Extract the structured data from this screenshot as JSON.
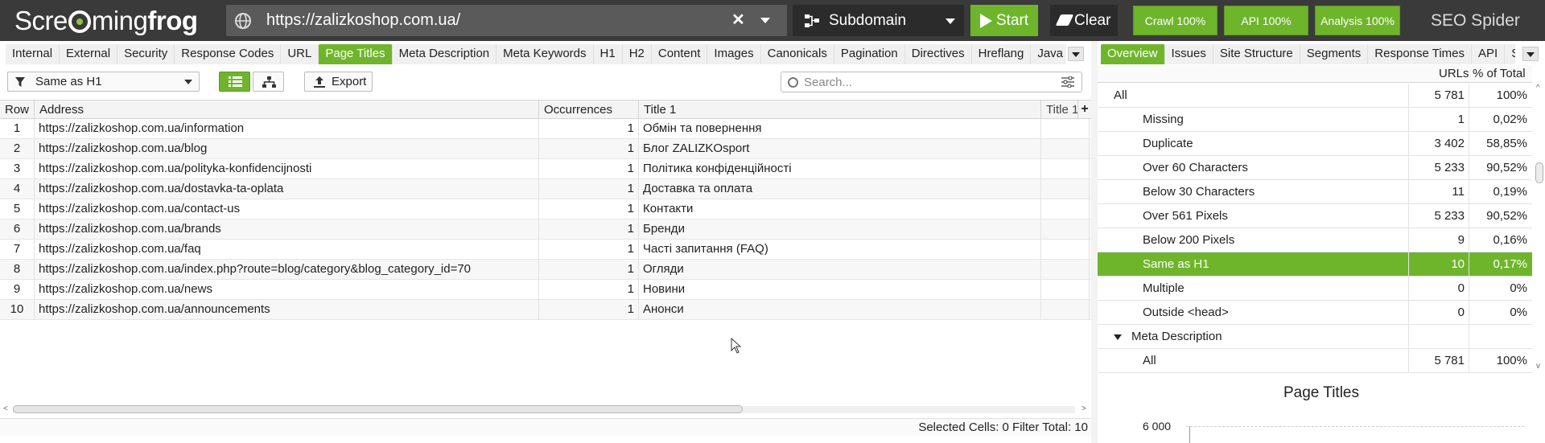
{
  "app": {
    "logo_part1": "Scre",
    "logo_part2": "ming",
    "logo_part3": "frog",
    "brand": "SEO Spider",
    "url": "https://zalizkoshop.com.ua/",
    "mode": "Subdomain",
    "start_label": "Start",
    "clear_label": "Clear",
    "status": {
      "crawl": "Crawl 100%",
      "api": "API 100%",
      "analysis": "Analysis 100%"
    }
  },
  "left_tabs": [
    "Internal",
    "External",
    "Security",
    "Response Codes",
    "URL",
    "Page Titles",
    "Meta Description",
    "Meta Keywords",
    "H1",
    "H2",
    "Content",
    "Images",
    "Canonicals",
    "Pagination",
    "Directives",
    "Hreflang",
    "Java"
  ],
  "left_active_tab": "Page Titles",
  "right_tabs": [
    "Overview",
    "Issues",
    "Site Structure",
    "Segments",
    "Response Times",
    "API",
    "S"
  ],
  "right_active_tab": "Overview",
  "toolbar": {
    "filter_label": "Same as H1",
    "export_label": "Export",
    "search_placeholder": "Search..."
  },
  "table": {
    "columns": [
      "Row",
      "Address",
      "Occurrences",
      "Title 1",
      "Title 1"
    ],
    "rows": [
      {
        "row": "1",
        "address": "https://zalizkoshop.com.ua/information",
        "occ": "1",
        "title": "Обмін та повернення"
      },
      {
        "row": "2",
        "address": "https://zalizkoshop.com.ua/blog",
        "occ": "1",
        "title": "Блог ZALIZKOsport"
      },
      {
        "row": "3",
        "address": "https://zalizkoshop.com.ua/polityka-konfidencijnosti",
        "occ": "1",
        "title": "Політика конфіденційності"
      },
      {
        "row": "4",
        "address": "https://zalizkoshop.com.ua/dostavka-ta-oplata",
        "occ": "1",
        "title": "Доставка та оплата"
      },
      {
        "row": "5",
        "address": "https://zalizkoshop.com.ua/contact-us",
        "occ": "1",
        "title": "Контакти"
      },
      {
        "row": "6",
        "address": "https://zalizkoshop.com.ua/brands",
        "occ": "1",
        "title": "Бренди"
      },
      {
        "row": "7",
        "address": "https://zalizkoshop.com.ua/faq",
        "occ": "1",
        "title": "Часті запитання (FAQ)"
      },
      {
        "row": "8",
        "address": "https://zalizkoshop.com.ua/index.php?route=blog/category&blog_category_id=70",
        "occ": "1",
        "title": "Огляди"
      },
      {
        "row": "9",
        "address": "https://zalizkoshop.com.ua/news",
        "occ": "1",
        "title": "Новини"
      },
      {
        "row": "10",
        "address": "https://zalizkoshop.com.ua/announcements",
        "occ": "1",
        "title": "Анонси"
      }
    ]
  },
  "statusbar": {
    "selected_cells": "Selected Cells:  0  Filter Total:  10"
  },
  "overview": {
    "col_urls": "URLs",
    "col_pct": "% of Total",
    "rows": [
      {
        "label": "All",
        "urls": "5 781",
        "pct": "100%",
        "indent": 1
      },
      {
        "label": "Missing",
        "urls": "1",
        "pct": "0,02%",
        "indent": 2
      },
      {
        "label": "Duplicate",
        "urls": "3 402",
        "pct": "58,85%",
        "indent": 2
      },
      {
        "label": "Over 60 Characters",
        "urls": "5 233",
        "pct": "90,52%",
        "indent": 2
      },
      {
        "label": "Below 30 Characters",
        "urls": "11",
        "pct": "0,19%",
        "indent": 2
      },
      {
        "label": "Over 561 Pixels",
        "urls": "5 233",
        "pct": "90,52%",
        "indent": 2
      },
      {
        "label": "Below 200 Pixels",
        "urls": "9",
        "pct": "0,16%",
        "indent": 2
      },
      {
        "label": "Same as H1",
        "urls": "10",
        "pct": "0,17%",
        "indent": 2,
        "selected": true
      },
      {
        "label": "Multiple",
        "urls": "0",
        "pct": "0%",
        "indent": 2
      },
      {
        "label": "Outside <head>",
        "urls": "0",
        "pct": "0%",
        "indent": 2
      },
      {
        "label": "Meta Description",
        "urls": "",
        "pct": "",
        "indent": 0,
        "section": true
      },
      {
        "label": "All",
        "urls": "5 781",
        "pct": "100%",
        "indent": 2
      }
    ]
  },
  "chart": {
    "title": "Page Titles",
    "ytick_top": "6 000"
  },
  "colors": {
    "accent": "#6fb52c",
    "topbar": "#3a3a3a"
  }
}
